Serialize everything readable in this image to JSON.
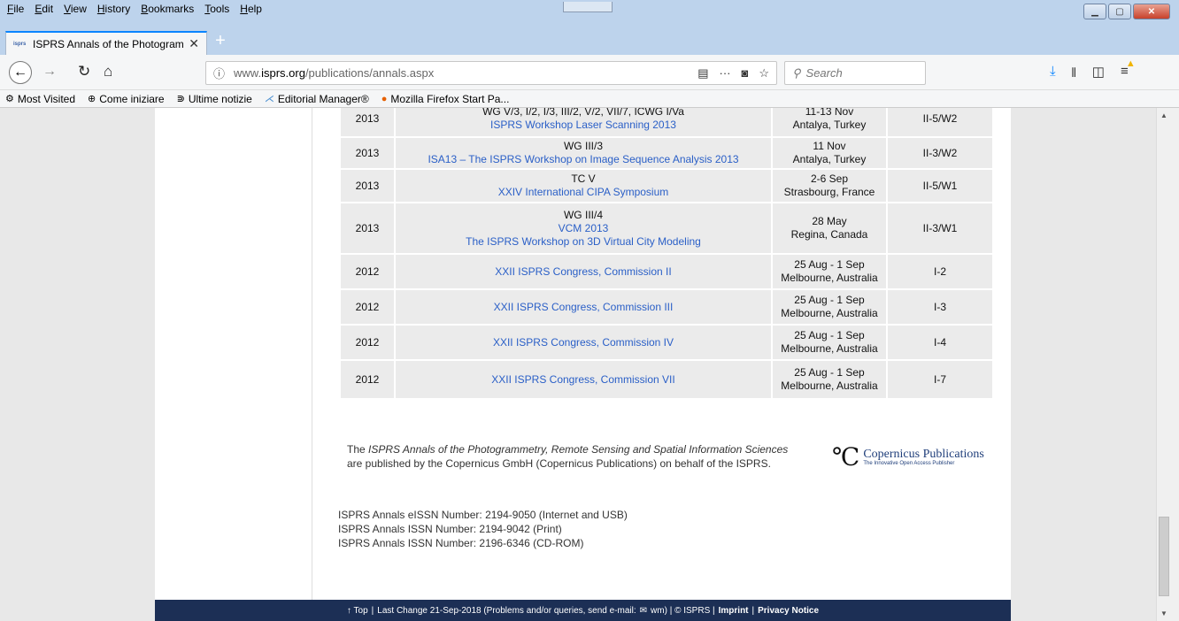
{
  "menubar": [
    "File",
    "Edit",
    "View",
    "History",
    "Bookmarks",
    "Tools",
    "Help"
  ],
  "tab": {
    "favicon": "isprs",
    "title": "ISPRS Annals of the Photogram",
    "close": "✕"
  },
  "url": {
    "host_prefix": "www.",
    "host": "isprs.org",
    "path": "/publications/annals.aspx"
  },
  "search_placeholder": "Search",
  "bookmarks": [
    "Most Visited",
    "Come iniziare",
    "Ultime notizie",
    "Editorial Manager®",
    "Mozilla Firefox Start Pa..."
  ],
  "rows": [
    {
      "year": "2013",
      "line1": "WG V/3, I/2, I/3, III/2, V/2, VII/7, ICWG I/Va",
      "link1": "ISPRS Workshop Laser Scanning 2013",
      "link2": "",
      "date": "11-13 Nov",
      "place": "Antalya, Turkey",
      "vol": "II-5/W2"
    },
    {
      "year": "2013",
      "line1": "WG III/3",
      "link1": "ISA13 – The ISPRS Workshop on Image Sequence Analysis 2013",
      "link2": "",
      "date": "11 Nov",
      "place": "Antalya, Turkey",
      "vol": "II-3/W2"
    },
    {
      "year": "2013",
      "line1": "TC V",
      "link1": "XXIV International CIPA Symposium",
      "link2": "",
      "date": "2-6 Sep",
      "place": "Strasbourg, France",
      "vol": "II-5/W1"
    },
    {
      "year": "2013",
      "line1": "WG III/4",
      "link1": "VCM 2013",
      "link2": "The ISPRS Workshop on 3D Virtual City Modeling",
      "date": "28 May",
      "place": "Regina, Canada",
      "vol": "II-3/W1"
    },
    {
      "year": "2012",
      "line1": "",
      "link1": "XXII ISPRS Congress, Commission II",
      "link2": "",
      "date": "25 Aug - 1 Sep",
      "place": "Melbourne, Australia",
      "vol": "I-2"
    },
    {
      "year": "2012",
      "line1": "",
      "link1": "XXII ISPRS Congress, Commission III",
      "link2": "",
      "date": "25 Aug - 1 Sep",
      "place": "Melbourne, Australia",
      "vol": "I-3"
    },
    {
      "year": "2012",
      "line1": "",
      "link1": "XXII ISPRS Congress, Commission IV",
      "link2": "",
      "date": "25 Aug - 1 Sep",
      "place": "Melbourne, Australia",
      "vol": "I-4"
    },
    {
      "year": "2012",
      "line1": "",
      "link1": "XXII ISPRS Congress, Commission VII",
      "link2": "",
      "date": "25 Aug - 1 Sep",
      "place": "Melbourne, Australia",
      "vol": "I-7"
    }
  ],
  "publisher": {
    "pre": "The ",
    "journal": "ISPRS Annals of the Photogrammetry, Remote Sensing and Spatial Information Sciences",
    "line2": "are published by the Copernicus GmbH (Copernicus Publications) on behalf of the ISPRS.",
    "logo_name": "Copernicus Publications",
    "logo_tag": "The Innovative Open Access Publisher"
  },
  "issn": [
    "ISPRS Annals eISSN Number: 2194-9050 (Internet and USB)",
    "ISPRS Annals ISSN Number: 2194-9042 (Print)",
    "ISPRS Annals ISSN Number: 2196-6346 (CD-ROM)"
  ],
  "footer": {
    "top": "↑ Top",
    "last_change": "Last Change 21-Sep-2018 (Problems and/or queries, send e-mail:",
    "mail_icon": "✉",
    "mail_tail": "wm) | © ISPRS |",
    "imprint": "Imprint",
    "privacy": "Privacy Notice"
  }
}
